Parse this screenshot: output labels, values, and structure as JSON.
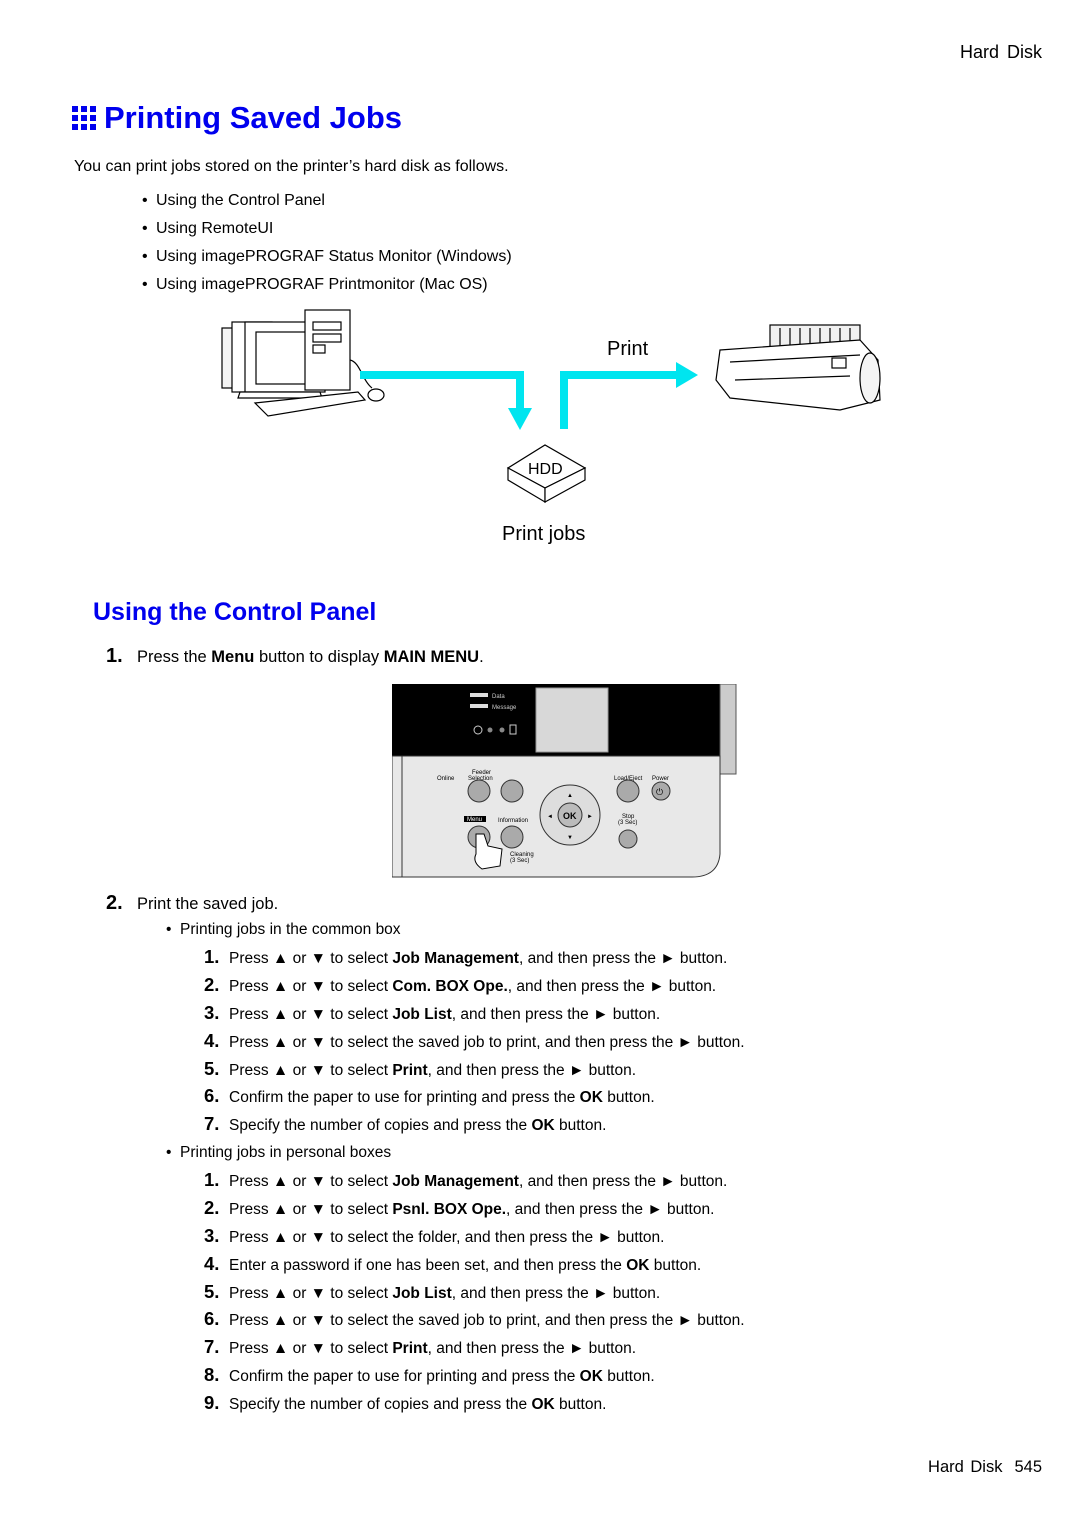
{
  "header": {
    "section": "Hard Disk"
  },
  "title": "Printing Saved Jobs",
  "intro": "You can print jobs stored on the printer’s hard disk as follows.",
  "methods": [
    "Using the Control Panel",
    "Using RemoteUI",
    "Using imagePROGRAF Status Monitor (Windows)",
    "Using imagePROGRAF Printmonitor (Mac OS)"
  ],
  "diagram": {
    "print_label": "Print",
    "hdd_label": "HDD",
    "jobs_label": "Print jobs",
    "arrow_color": "#00e5ef",
    "icons": [
      "computer-icon",
      "printer-icon",
      "hdd-icon"
    ]
  },
  "section_heading": "Using the Control Panel",
  "step1": {
    "num": "1.",
    "pre": "Press the ",
    "b1": "Menu",
    "mid": " button to display ",
    "b2": "MAIN MENU",
    "post": "."
  },
  "panel": {
    "lamps": [
      "Data",
      "Message"
    ],
    "buttons": {
      "online": "Online",
      "feeder": "Feeder",
      "feeder2": "Selection",
      "load_eject": "Load/Eject",
      "power": "Power",
      "menu": "Menu",
      "information": "Information",
      "ok": "OK",
      "stop": "Stop",
      "stop2": "(3 Sec)",
      "cleaning": "Cleaning",
      "cleaning2": "(3 Sec)"
    }
  },
  "step2": {
    "num": "2.",
    "text": "Print the saved job."
  },
  "common_box": {
    "label": "Printing jobs in the common box",
    "steps": [
      {
        "n": "1.",
        "pre": "Press ▲ or ▼ to select ",
        "b": "Job Management",
        "post": ", and then press the ► button."
      },
      {
        "n": "2.",
        "pre": "Press ▲ or ▼ to select ",
        "b": "Com. BOX Ope.",
        "post": ", and then press the ► button."
      },
      {
        "n": "3.",
        "pre": "Press ▲ or ▼ to select ",
        "b": "Job List",
        "post": ", and then press the ► button."
      },
      {
        "n": "4.",
        "pre": "Press ▲ or ▼ to select the saved job to print, and then press the ► button.",
        "b": "",
        "post": ""
      },
      {
        "n": "5.",
        "pre": "Press ▲ or ▼ to select ",
        "b": "Print",
        "post": ", and then press the ► button."
      },
      {
        "n": "6.",
        "pre": "Confirm the paper to use for printing and press the ",
        "b": "OK",
        "post": " button."
      },
      {
        "n": "7.",
        "pre": "Specify the number of copies and press the ",
        "b": "OK",
        "post": " button."
      }
    ]
  },
  "personal_box": {
    "label": "Printing jobs in personal boxes",
    "steps": [
      {
        "n": "1.",
        "pre": "Press ▲ or ▼ to select ",
        "b": "Job Management",
        "post": ", and then press the ► button."
      },
      {
        "n": "2.",
        "pre": "Press ▲ or ▼ to select ",
        "b": "Psnl. BOX Ope.",
        "post": ", and then press the ► button."
      },
      {
        "n": "3.",
        "pre": "Press ▲ or ▼ to select the folder, and then press the ► button.",
        "b": "",
        "post": ""
      },
      {
        "n": "4.",
        "pre": "Enter a password if one has been set, and then press the ",
        "b": "OK",
        "post": " button."
      },
      {
        "n": "5.",
        "pre": "Press ▲ or ▼ to select ",
        "b": "Job List",
        "post": ", and then press the ► button."
      },
      {
        "n": "6.",
        "pre": "Press ▲ or ▼ to select the saved job to print, and then press the ► button.",
        "b": "",
        "post": ""
      },
      {
        "n": "7.",
        "pre": "Press ▲ or ▼ to select ",
        "b": "Print",
        "post": ", and then press the ► button."
      },
      {
        "n": "8.",
        "pre": "Confirm the paper to use for printing and press the ",
        "b": "OK",
        "post": " button."
      },
      {
        "n": "9.",
        "pre": "Specify the number of copies and press the ",
        "b": "OK",
        "post": " button."
      }
    ]
  },
  "footer": {
    "section": "Hard Disk",
    "page": "545"
  }
}
